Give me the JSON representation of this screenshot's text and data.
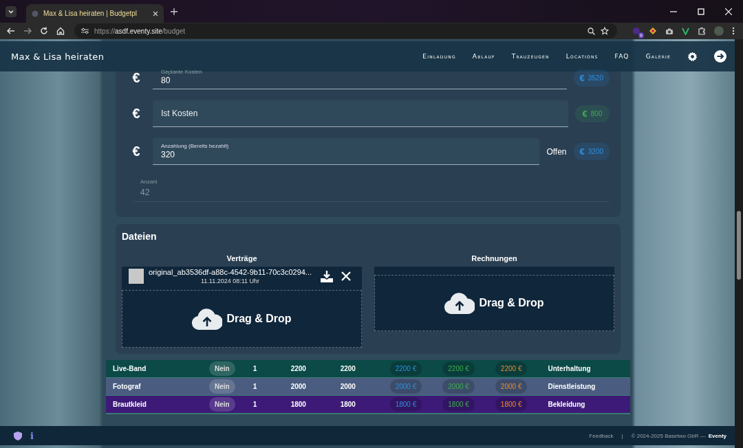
{
  "browser": {
    "tab_title": "Max & Lisa heiraten | Budgetpl",
    "url_host": "asdf.eventy.site",
    "url_scheme": "https://",
    "url_path": "/budget",
    "extension_badge": "9"
  },
  "header": {
    "brand": "Max & Lisa heiraten",
    "nav": [
      "Einladung",
      "Ablauf",
      "Trauzeugen",
      "Locations",
      "FAQ",
      "Galerie"
    ]
  },
  "costs": [
    {
      "kind": "field",
      "symbol": "€",
      "label": "Geplante Kosten",
      "value": "80",
      "chip_symbol": "€",
      "chip": "3520",
      "color": "#2f8fe0"
    },
    {
      "kind": "field",
      "symbol": "€",
      "placeholder": "Ist Kosten",
      "chip_symbol": "€",
      "chip": "800",
      "color": "#3fae4f"
    },
    {
      "kind": "field",
      "symbol": "€",
      "label": "Anzahlung (Bereits bezahlt)",
      "value": "320",
      "note": "Offen",
      "chip_symbol": "€",
      "chip": "3200",
      "color": "#2f8fe0"
    },
    {
      "kind": "readonly",
      "label": "Anzahl",
      "value": "42"
    }
  ],
  "files": {
    "title": "Dateien",
    "columns": [
      {
        "heading": "Verträge",
        "files": [
          {
            "name": "original_ab3536df-a88c-4542-9b11-70c3c0294...",
            "date": "11.11.2024 08:11 Uhr"
          }
        ],
        "drop": "Drag & Drop"
      },
      {
        "heading": "Rechnungen",
        "drop": "Drag & Drop"
      }
    ]
  },
  "rows": [
    {
      "name": "Live-Band",
      "flag": "Nein",
      "count": "1",
      "planned": "2200",
      "actual": "2200",
      "chip_1": "2200 €",
      "chip_2": "2200 €",
      "chip_3": "2200 €",
      "category": "Unterhaltung",
      "color": "#0b4a47"
    },
    {
      "name": "Fotograf",
      "flag": "Nein",
      "count": "1",
      "planned": "2000",
      "actual": "2000",
      "chip_1": "2000 €",
      "chip_2": "2000 €",
      "chip_3": "2000 €",
      "category": "Dienstleistung",
      "color": "#4a5d80"
    },
    {
      "name": "Brautkleid",
      "flag": "Nein",
      "count": "1",
      "planned": "1800",
      "actual": "1800",
      "chip_1": "1800 €",
      "chip_2": "1800 €",
      "chip_3": "1800 €",
      "category": "Bekleidung",
      "color": "#3d1a78"
    }
  ],
  "footer": {
    "info": "i",
    "feedback": "Feedback",
    "separator": "|",
    "copyright": "© 2024-2025 Basetwo GbR —",
    "brand": "Eventy"
  }
}
